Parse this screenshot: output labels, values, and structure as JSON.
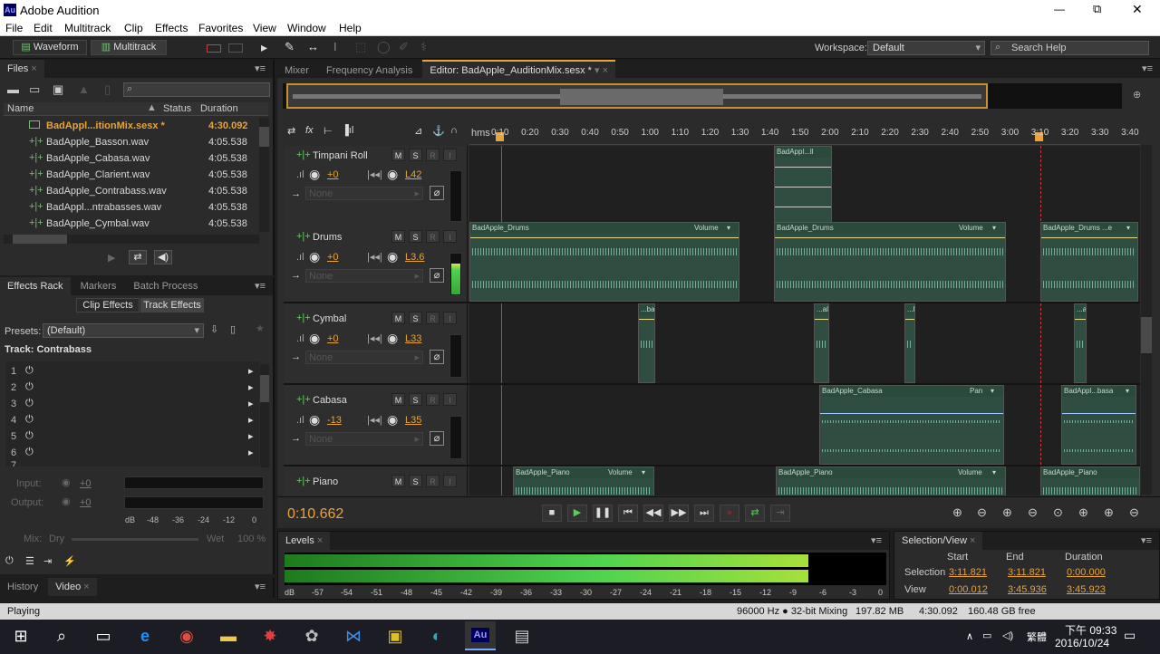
{
  "window": {
    "app_icon": "Au",
    "title": "Adobe Audition",
    "minimize": "—",
    "maximize": "⧉",
    "close": "✕"
  },
  "menu": [
    "File",
    "Edit",
    "Multitrack",
    "Clip",
    "Effects",
    "Favorites",
    "View",
    "Window",
    "Help"
  ],
  "toolbar": {
    "waveform_label": "Waveform",
    "multitrack_label": "Multitrack",
    "workspace_label": "Workspace:",
    "workspace_value": "Default",
    "search_placeholder": "Search Help"
  },
  "files": {
    "tab_label": "Files",
    "col_name": "Name",
    "col_status": "Status",
    "col_duration": "Duration",
    "rows": [
      {
        "name": "BadAppl...itionMix.sesx *",
        "duration": "4:30.092"
      },
      {
        "name": "BadApple_Basson.wav",
        "duration": "4:05.538"
      },
      {
        "name": "BadApple_Cabasa.wav",
        "duration": "4:05.538"
      },
      {
        "name": "BadApple_Clarient.wav",
        "duration": "4:05.538"
      },
      {
        "name": "BadApple_Contrabass.wav",
        "duration": "4:05.538"
      },
      {
        "name": "BadAppl...ntrabasses.wav",
        "duration": "4:05.538"
      },
      {
        "name": "BadApple_Cymbal.wav",
        "duration": "4:05.538"
      }
    ]
  },
  "effects": {
    "tabs": [
      "Effects Rack",
      "Markers",
      "Batch Process"
    ],
    "clip_effects": "Clip Effects",
    "track_effects": "Track Effects",
    "presets_label": "Presets:",
    "presets_value": "(Default)",
    "track_label": "Track: Contrabass",
    "slots": [
      "1",
      "2",
      "3",
      "4",
      "5",
      "6",
      "7"
    ],
    "input_label": "Input:",
    "output_label": "Output:",
    "gain": "+0",
    "scale": [
      "dB",
      "-48",
      "-36",
      "-24",
      "-12",
      "0"
    ],
    "mix_label": "Mix:",
    "dry": "Dry",
    "wet": "Wet",
    "wet_pct": "100 %"
  },
  "bottom_tabs": [
    "History",
    "Video"
  ],
  "editor": {
    "tabs": [
      "Mixer",
      "Frequency Analysis",
      "Editor: BadApple_AuditionMix.sesx *"
    ],
    "ruler_unit": "hms",
    "ruler": [
      "0:10",
      "0:20",
      "0:30",
      "0:40",
      "0:50",
      "1:00",
      "1:10",
      "1:20",
      "1:30",
      "1:40",
      "1:50",
      "2:00",
      "2:10",
      "2:20",
      "2:30",
      "2:40",
      "2:50",
      "3:00",
      "3:10",
      "3:20",
      "3:30",
      "3:40"
    ],
    "tracks": [
      {
        "name": "Timpani Roll",
        "vol": "+0",
        "pan": "L42",
        "input": "None"
      },
      {
        "name": "Drums",
        "vol": "+0",
        "pan": "L3.6",
        "input": "None"
      },
      {
        "name": "Cymbal",
        "vol": "+0",
        "pan": "L33",
        "input": "None"
      },
      {
        "name": "Cabasa",
        "vol": "-13",
        "pan": "L35",
        "input": "None"
      },
      {
        "name": "Piano",
        "vol": "",
        "pan": "",
        "input": ""
      }
    ],
    "msri": [
      "M",
      "S",
      "R",
      "I"
    ],
    "clips": {
      "timpani": "BadAppl...ll",
      "drums1": "BadApple_Drums",
      "drums2": "BadApple_Drums",
      "drums3": "BadApple_Drums ...e",
      "volume": "Volume",
      "pan": "Pan",
      "cym1": "...bal",
      "cym2": "...al",
      "cym3": "...l",
      "cym4": "...al",
      "cab1": "BadApple_Cabasa",
      "cab2": "BadAppl...basa",
      "piano1": "BadApple_Piano",
      "piano2": "BadApple_Piano",
      "piano3": "BadApple_Piano"
    },
    "time": "0:10.662"
  },
  "levels": {
    "tab": "Levels",
    "scale": [
      "dB",
      "-57",
      "-54",
      "-51",
      "-48",
      "-45",
      "-42",
      "-39",
      "-36",
      "-33",
      "-30",
      "-27",
      "-24",
      "-21",
      "-18",
      "-15",
      "-12",
      "-9",
      "-6",
      "-3",
      "0"
    ],
    "level_fraction": 0.87
  },
  "selview": {
    "tab": "Selection/View",
    "cols": [
      "Start",
      "End",
      "Duration"
    ],
    "selection_label": "Selection",
    "sel_start": "3:11.821",
    "sel_end": "3:11.821",
    "sel_dur": "0:00.000",
    "view_label": "View",
    "view_start": "0:00.012",
    "view_end": "3:45.936",
    "view_dur": "3:45.923"
  },
  "status": {
    "left": "Playing",
    "rate": "96000 Hz ● 32-bit Mixing",
    "mem": "197.82 MB",
    "dur": "4:30.092",
    "free": "160.48 GB free"
  },
  "taskbar": {
    "lang": "繁體",
    "time": "下午 09:33",
    "date": "2016/10/24",
    "au_label": "Au"
  },
  "colors": {
    "accent": "#e8a33a",
    "clip_green": "#2f4d40",
    "meter_green": "#4fd34f",
    "playhead": "#d13a3a"
  }
}
